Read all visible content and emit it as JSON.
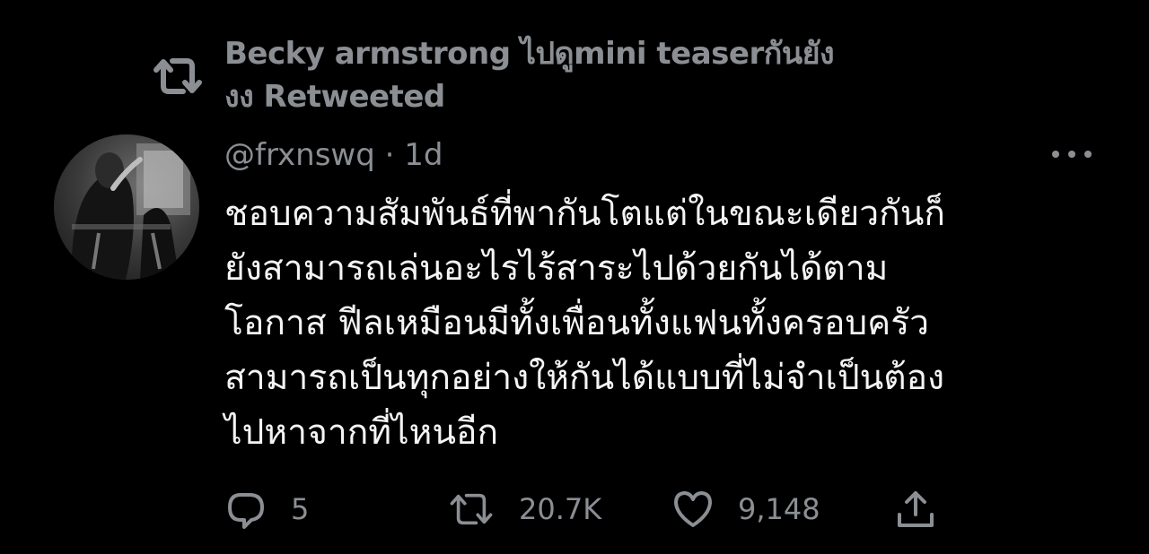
{
  "retweet_header": {
    "icon": "retweet-icon",
    "line1": "Becky armstrong ไปดูmini teaserกันยัง",
    "line2": "งง Retweeted"
  },
  "tweet": {
    "avatar": "avatar",
    "handle": "@frxnswq",
    "separator": "·",
    "time": "1d",
    "more_icon": "more-icon",
    "lines": [
      "ชอบความสัมพันธ์ที่พากันโตแต่ในขณะเดียวกันก็",
      "ยังสามารถเล่นอะไรไร้สาระไปด้วยกันได้ตาม",
      "โอกาส ฟีลเหมือนมีทั้งเพื่อนทั้งแฟนทั้งครอบครัว",
      "สามารถเป็นทุกอย่างให้กันได้แบบที่ไม่จำเป็นต้อง",
      "ไปหาจากที่ไหนอีก"
    ]
  },
  "actions": {
    "reply": {
      "icon": "reply-icon",
      "count": "5"
    },
    "retweet": {
      "icon": "retweet-icon",
      "count": "20.7K"
    },
    "like": {
      "icon": "heart-icon",
      "count": "9,148"
    },
    "share": {
      "icon": "share-icon"
    }
  },
  "colors": {
    "background": "#000000",
    "muted_text": "#8b8f94",
    "primary_text": "#f4f4f4"
  }
}
